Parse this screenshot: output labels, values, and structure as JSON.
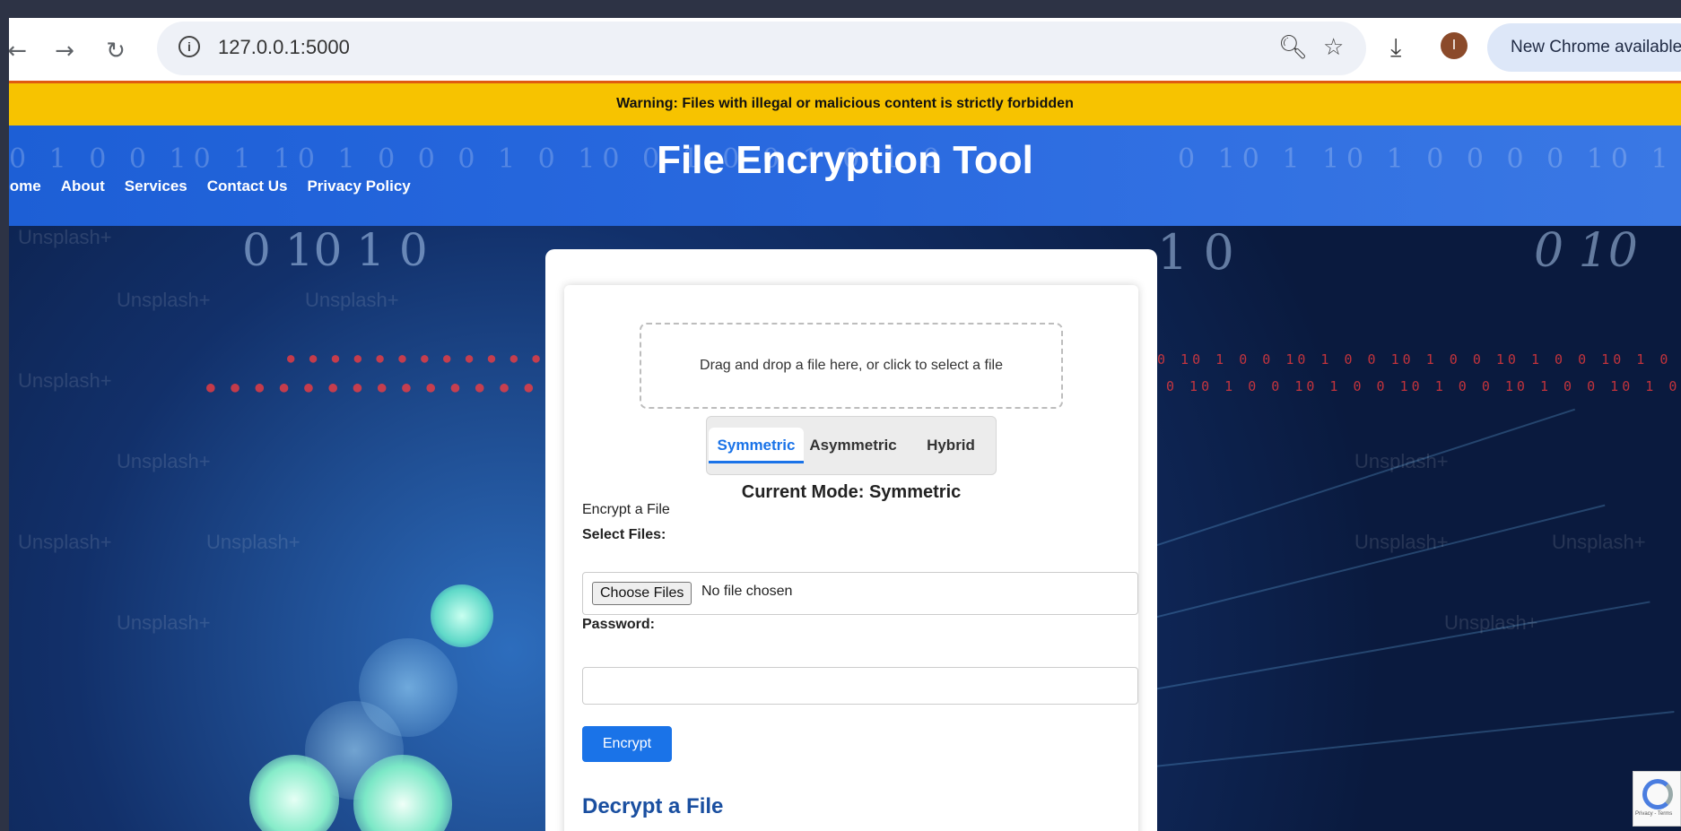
{
  "browser": {
    "back_icon": "back-arrow-icon",
    "forward_icon": "forward-arrow-icon",
    "reload_icon": "reload-icon",
    "url": "127.0.0.1:5000",
    "update_label": "New Chrome available"
  },
  "warning": {
    "text": "Warning: Files with illegal or malicious content is strictly forbidden"
  },
  "header": {
    "title": "File Encryption Tool",
    "nav": [
      "lome",
      "About",
      "Services",
      "Contact Us",
      "Privacy Policy"
    ]
  },
  "form": {
    "dropzone_text": "Drag and drop a file here, or click to select a file",
    "modes": [
      "Symmetric",
      "Asymmetric",
      "Hybrid"
    ],
    "current_mode": "Current Mode: Symmetric",
    "encrypt_section": "Encrypt a File",
    "select_files_label": "Select Files:",
    "choose_files_label": "Choose Files",
    "file_status": "No file chosen",
    "password_label": "Password:",
    "password_value": "",
    "encrypt_button": "Encrypt",
    "decrypt_title": "Decrypt a File"
  },
  "background": {
    "watermark": "Unsplash+",
    "binary_header": "0 1 0    0 10 1 10 1 0 0 0 1 0 10 0 1 0 0 1 0 1 0",
    "binary_header_right": "0 10 1 10 1 0 0 0 0 10 1 0 0    10 1 0    0 10",
    "binary_hero_left": "0  10  1  0",
    "binary_hero_right": "1 0",
    "binary_hero_far_right": "0   10"
  },
  "recaptcha": {
    "text": "Privacy - Terms"
  }
}
